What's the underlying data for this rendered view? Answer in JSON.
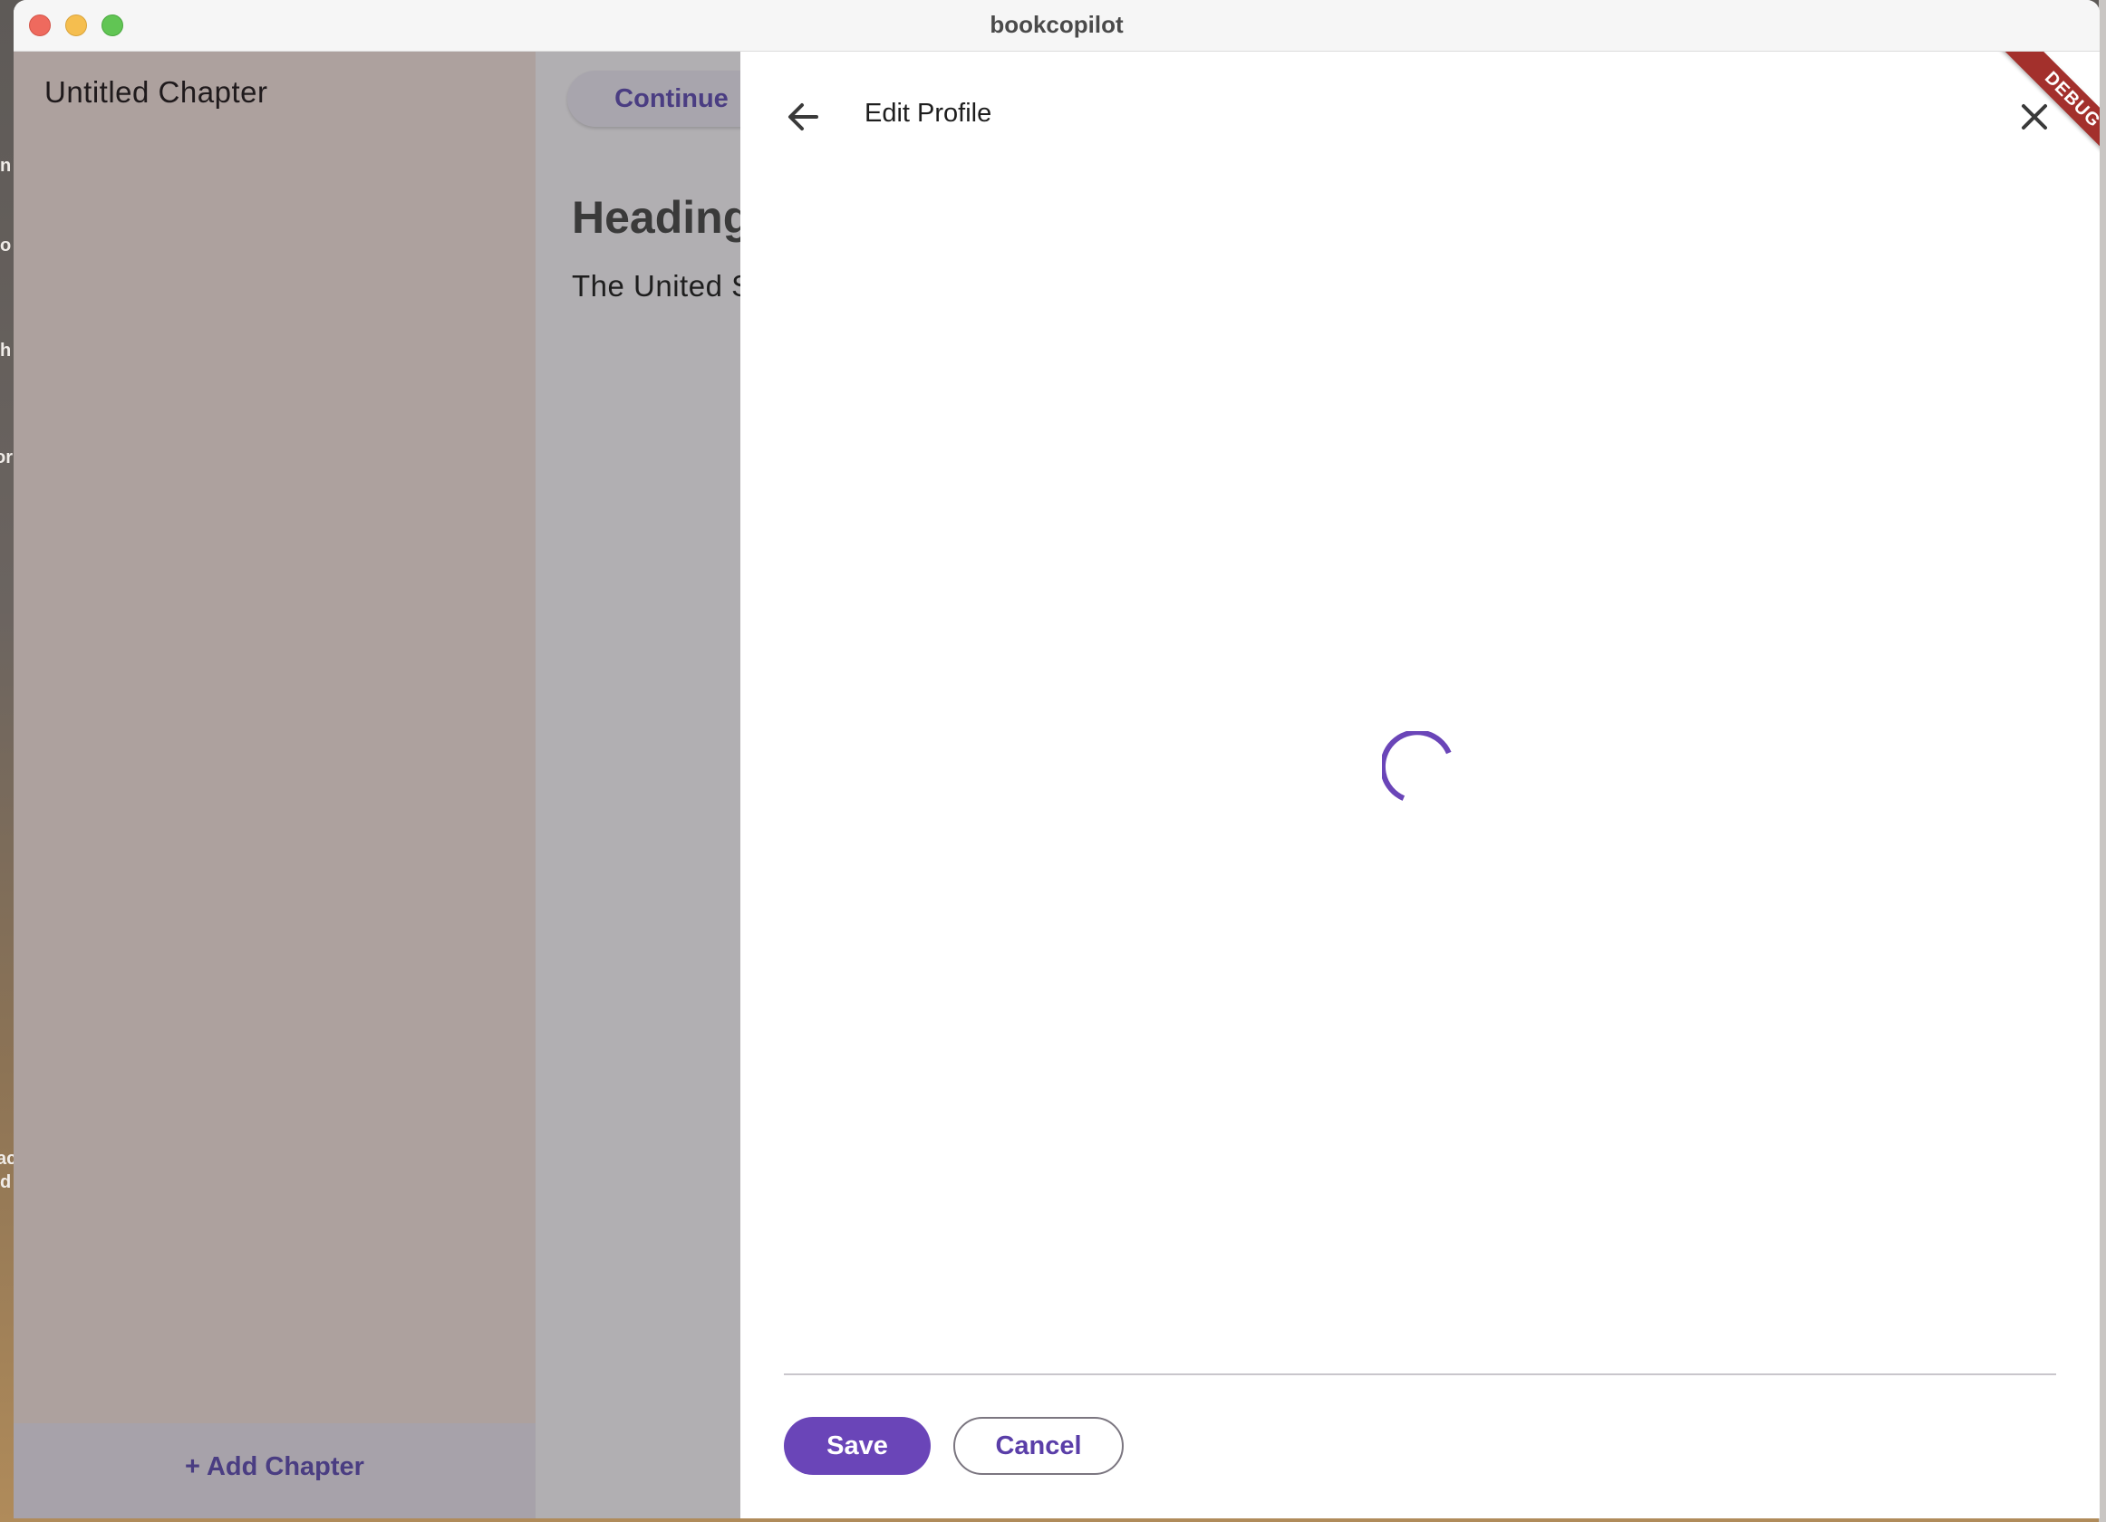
{
  "window": {
    "title": "bookcopilot"
  },
  "desktop": {
    "edge_fragments": [
      "n",
      "o",
      "h",
      "or",
      "ac",
      "d"
    ]
  },
  "sidebar": {
    "chapter_title": "Untitled Chapter",
    "add_chapter_label": "+ Add Chapter"
  },
  "editor": {
    "continue_label": "Continue",
    "heading": "Heading",
    "body_text": "The United S"
  },
  "panel": {
    "back_icon": "arrow-left-icon",
    "title": "Edit Profile",
    "close_icon": "close-icon",
    "loading": true,
    "save_label": "Save",
    "cancel_label": "Cancel"
  },
  "debug_banner": {
    "label": "DEBUG"
  },
  "colors": {
    "accent": "#6a45b8",
    "accent_text": "#5a3ea8",
    "debug_banner": "#a3302c",
    "sidebar_scrim": "#ada19e"
  }
}
